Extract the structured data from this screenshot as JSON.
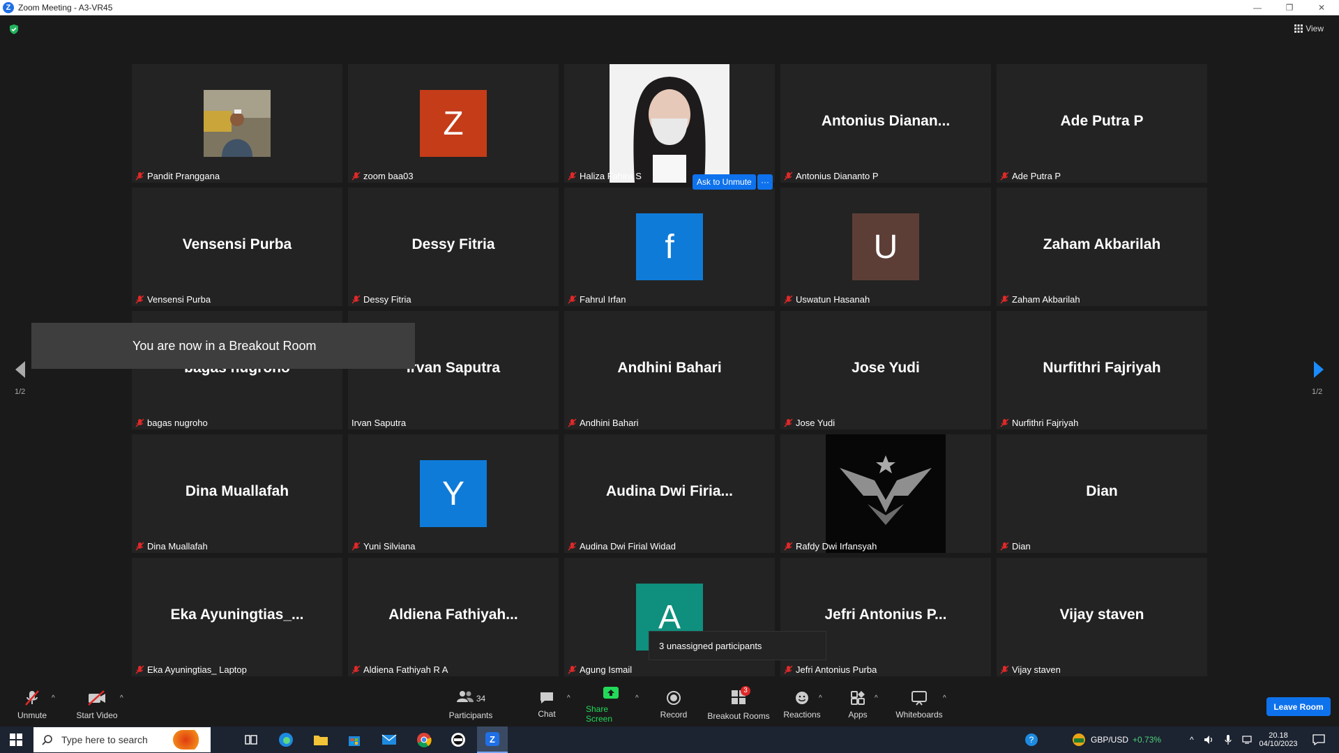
{
  "window": {
    "title": "Zoom Meeting - A3-VR45",
    "app_icon": "zoom-logo"
  },
  "header": {
    "view_label": "View"
  },
  "pager": {
    "left_label": "1/2",
    "right_label": "1/2"
  },
  "tiles": [
    {
      "display": "",
      "label": "Pandit Pranggana",
      "type": "photo"
    },
    {
      "display": "Z",
      "label": "zoom baa03",
      "type": "avatar",
      "color": "#c43c18"
    },
    {
      "display": "",
      "label": "Haliza Fahira S",
      "type": "photo"
    },
    {
      "display": "Antonius  Dianan...",
      "label": "Antonius Diananto P",
      "type": "name"
    },
    {
      "display": "Ade Putra P",
      "label": "Ade Putra P",
      "type": "name"
    },
    {
      "display": "Vensensi Purba",
      "label": "Vensensi Purba",
      "type": "name"
    },
    {
      "display": "Dessy Fitria",
      "label": "Dessy Fitria",
      "type": "name"
    },
    {
      "display": "f",
      "label": "Fahrul Irfan",
      "type": "avatar",
      "color": "#0f7bd8"
    },
    {
      "display": "U",
      "label": "Uswatun Hasanah",
      "type": "avatar",
      "color": "#5d3e36"
    },
    {
      "display": "Zaham Akbarilah",
      "label": "Zaham Akbarilah",
      "type": "name"
    },
    {
      "display": "bagas nugroho",
      "label": "bagas nugroho",
      "type": "name"
    },
    {
      "display": "Irvan Saputra",
      "label": "Irvan Saputra",
      "type": "name",
      "unmuted": true
    },
    {
      "display": "Andhini Bahari",
      "label": "Andhini Bahari",
      "type": "name"
    },
    {
      "display": "Jose Yudi",
      "label": "Jose Yudi",
      "type": "name"
    },
    {
      "display": "Nurfithri Fajriyah",
      "label": "Nurfithri Fajriyah",
      "type": "name"
    },
    {
      "display": "Dina Muallafah",
      "label": "Dina Muallafah",
      "type": "name"
    },
    {
      "display": "Y",
      "label": "Yuni Silviana",
      "type": "avatar",
      "color": "#0f7bd8"
    },
    {
      "display": "Audina  Dwi  Firia...",
      "label": "Audina Dwi Firial Widad",
      "type": "name"
    },
    {
      "display": "",
      "label": "Rafdy Dwi Irfansyah",
      "type": "logo"
    },
    {
      "display": "Dian",
      "label": "Dian",
      "type": "name"
    },
    {
      "display": "Eka  Ayuningtias_...",
      "label": "Eka Ayuningtias_ Laptop",
      "type": "name"
    },
    {
      "display": "Aldiena  Fathiyah...",
      "label": "Aldiena Fathiyah R A",
      "type": "name"
    },
    {
      "display": "A",
      "label": "Agung Ismail",
      "type": "avatar",
      "color": "#0f8f7e"
    },
    {
      "display": "Jefri  Antonius  P...",
      "label": "Jefri Antonius Purba",
      "type": "name"
    },
    {
      "display": "Vijay staven",
      "label": "Vijay staven",
      "type": "name"
    }
  ],
  "toast": {
    "text": "You are now in a Breakout Room"
  },
  "ask_unmute": {
    "label": "Ask to Unmute",
    "more": "···"
  },
  "tooltip": {
    "text": "3 unassigned participants"
  },
  "toolbar": {
    "unmute": "Unmute",
    "start_video": "Start Video",
    "participants": "Participants",
    "participant_count": "34",
    "chat": "Chat",
    "share_screen": "Share Screen",
    "record": "Record",
    "breakout_rooms": "Breakout Rooms",
    "breakout_badge": "3",
    "reactions": "Reactions",
    "apps": "Apps",
    "whiteboards": "Whiteboards",
    "leave": "Leave Room"
  },
  "taskbar": {
    "search_placeholder": "Type here to search",
    "ticker": "GBP/USD",
    "ticker_change": "+0.73%",
    "time": "20.18",
    "date": "04/10/2023"
  },
  "colors": {
    "accent": "#0e72ed",
    "share_green": "#23d959",
    "mute_red": "#e02828",
    "ticker_green": "#4ed37a"
  }
}
